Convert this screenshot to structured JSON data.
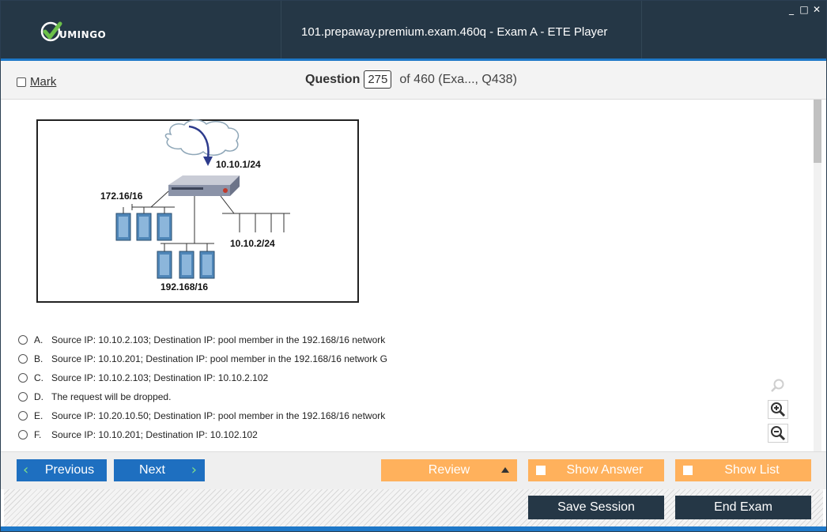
{
  "app": {
    "title": "101.prepaway.premium.exam.460q - Exam A - ETE Player",
    "logo_text": "UMINGO",
    "window_controls": [
      "_",
      "□",
      "✕"
    ]
  },
  "question_header": {
    "mark_label": "Mark",
    "question_label": "Question",
    "question_number": "275",
    "question_of": "of 460 (Exa..., Q438)"
  },
  "diagram": {
    "labels": {
      "vip": "10.10.1/24",
      "left_net": "172.16/16",
      "right_net": "10.10.2/24",
      "bottom_net": "192.168/16"
    }
  },
  "options": [
    {
      "letter": "A.",
      "text": "Source IP: 10.10.2.103; Destination IP: pool member in the 192.168/16 network"
    },
    {
      "letter": "B.",
      "text": "Source IP: 10.10.201; Destination IP: pool member in the 192.168/16 network G"
    },
    {
      "letter": "C.",
      "text": "Source IP: 10.10.2.103; Destination IP: 10.10.2.102"
    },
    {
      "letter": "D.",
      "text": "The request will be dropped."
    },
    {
      "letter": "E.",
      "text": "Source IP: 10.20.10.50; Destination IP: pool member in the 192.168/16 network"
    },
    {
      "letter": "F.",
      "text": "Source IP: 10.10.201; Destination IP: 10.102.102"
    }
  ],
  "nav": {
    "previous": "Previous",
    "next": "Next",
    "review": "Review",
    "show_answer": "Show Answer",
    "show_list": "Show List"
  },
  "footer": {
    "save_session": "Save Session",
    "end_exam": "End Exam"
  },
  "colors": {
    "titlebar": "#253746",
    "accent_blue": "#1e6fc0",
    "orange": "#ffb15c",
    "logo_green": "#6cc04a"
  }
}
